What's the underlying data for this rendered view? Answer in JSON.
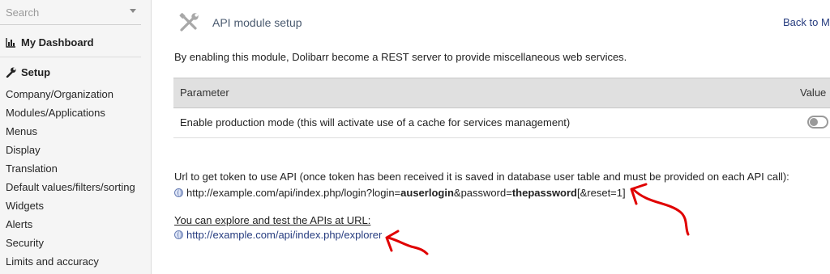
{
  "sidebar": {
    "search_placeholder": "Search",
    "dashboard_label": "My Dashboard",
    "setup_label": "Setup",
    "items": [
      {
        "label": "Company/Organization"
      },
      {
        "label": "Modules/Applications"
      },
      {
        "label": "Menus"
      },
      {
        "label": "Display"
      },
      {
        "label": "Translation"
      },
      {
        "label": "Default values/filters/sorting"
      },
      {
        "label": "Widgets"
      },
      {
        "label": "Alerts"
      },
      {
        "label": "Security"
      },
      {
        "label": "Limits and accuracy"
      }
    ]
  },
  "header": {
    "title": "API module setup",
    "back_link": "Back to Mo"
  },
  "main": {
    "intro": "By enabling this module, Dolibarr become a REST server to provide miscellaneous web services.",
    "table": {
      "col_parameter": "Parameter",
      "col_value": "Value",
      "rows": [
        {
          "parameter": "Enable production mode (this will activate use of a cache for services management)",
          "enabled": false
        }
      ]
    },
    "token_note": "Url to get token to use API (once token has been received it is saved in database user table and must be provided on each API call):",
    "token_url": {
      "part1": "http://example.com/api/index.php/login?login=",
      "bold1": "auserlogin",
      "part2": "&password=",
      "bold2": "thepassword",
      "part3": "[&reset=1]"
    },
    "explore_note": "You can explore and test the APIs at URL:",
    "explore_url": "http://example.com/api/index.php/explorer"
  },
  "colors": {
    "annotation": "#e00000",
    "link": "#263c7f",
    "title": "#4a5a6f"
  },
  "icons": {
    "dashboard": "bar-chart-icon",
    "setup": "wrench-icon",
    "title": "tools-icon",
    "toggle": "toggle-off-icon",
    "url": "globe-icon"
  }
}
